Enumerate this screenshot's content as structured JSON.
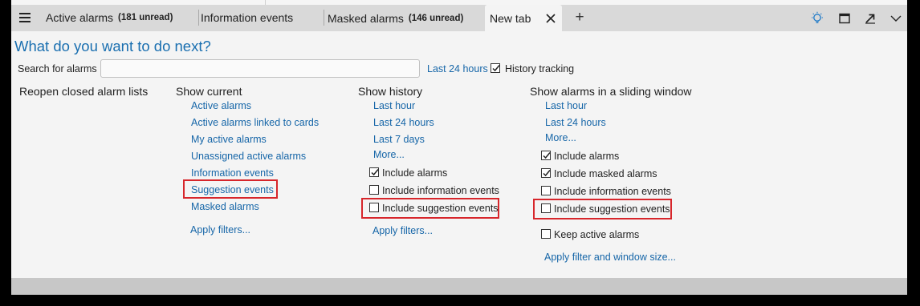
{
  "tabs": [
    {
      "label": "Active alarms",
      "badge": "(181 unread)"
    },
    {
      "label": "Information events",
      "badge": ""
    },
    {
      "label": "Masked alarms",
      "badge": "(146 unread)"
    },
    {
      "label": "New tab",
      "badge": ""
    }
  ],
  "heading": "What do you want to do next?",
  "search": {
    "label": "Search for alarms",
    "value": "",
    "time_link": "Last 24 hours",
    "history_tracking_label": "History tracking",
    "history_tracking_checked": true
  },
  "reopen": {
    "title": "Reopen closed alarm lists"
  },
  "show_current": {
    "title": "Show current",
    "links": [
      "Active alarms",
      "Active alarms linked to cards",
      "My active alarms",
      "Unassigned active alarms",
      "Information events",
      "Suggestion events",
      "Masked alarms"
    ],
    "apply": "Apply filters..."
  },
  "show_history": {
    "title": "Show history",
    "links": [
      "Last hour",
      "Last 24 hours",
      "Last 7 days",
      "More..."
    ],
    "options": [
      {
        "label": "Include alarms",
        "checked": true
      },
      {
        "label": "Include information events",
        "checked": false
      },
      {
        "label": "Include suggestion events",
        "checked": false
      }
    ],
    "apply": "Apply filters..."
  },
  "sliding": {
    "title": "Show alarms in a sliding window",
    "links": [
      "Last hour",
      "Last 24 hours",
      "More..."
    ],
    "options": [
      {
        "label": "Include alarms",
        "checked": true
      },
      {
        "label": "Include masked alarms",
        "checked": true
      },
      {
        "label": "Include information events",
        "checked": false
      },
      {
        "label": "Include suggestion events",
        "checked": false
      },
      {
        "label": "Keep active alarms",
        "checked": false
      }
    ],
    "apply": "Apply filter and window size..."
  },
  "colors": {
    "link": "#1666a8",
    "heading": "#1a6fb0",
    "highlight": "#d7262b"
  }
}
